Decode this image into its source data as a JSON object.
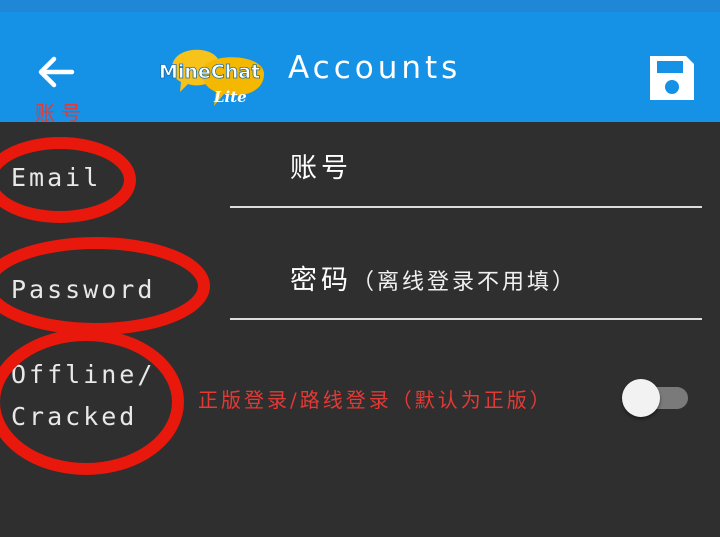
{
  "appbar": {
    "title": "Accounts",
    "back_icon": "arrow-left-icon",
    "save_icon": "floppy-disk-icon",
    "logo": {
      "name": "MineChat",
      "edition": "Lite"
    }
  },
  "annotations": {
    "top_note": "账号",
    "cracked_note": "正版登录/路线登录（默认为正版）"
  },
  "form": {
    "email": {
      "label": "Email",
      "value": "账号"
    },
    "password": {
      "label": "Password",
      "value": "密码",
      "hint": "（离线登录不用填）"
    },
    "offline": {
      "label_line1": "Offline/",
      "label_line2": "Cracked",
      "enabled": false
    }
  },
  "colors": {
    "appbar": "#1592e6",
    "background": "#2f2f2f",
    "annotation": "#e53935"
  }
}
